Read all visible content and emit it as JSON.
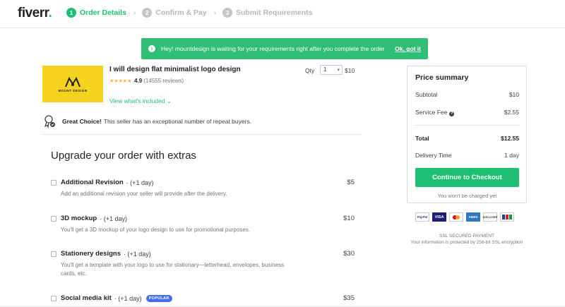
{
  "header": {
    "logo_text": "fiverr",
    "logo_dot": ".",
    "steps": [
      {
        "num": "1",
        "label": "Order Details"
      },
      {
        "num": "2",
        "label": "Confirm & Pay"
      },
      {
        "num": "3",
        "label": "Submit Requirements"
      }
    ],
    "separator": "›"
  },
  "notice": {
    "icon": "i",
    "message": "Hey! mountdesign is waiting for your requirements right after you complete the order",
    "ok_label": "Ok, got it"
  },
  "gig": {
    "thumb_brand": "MOUNT DESIGN",
    "title": "I will design flat minimalist logo design",
    "stars": "★★★★★",
    "score": "4.9",
    "reviews": "(14555 reviews)",
    "dots": "·",
    "view_included": "View what's included ⌄",
    "qty_label": "Qty",
    "qty_value": "1",
    "price": "$10"
  },
  "great_choice": {
    "bold": "Great Choice!",
    "text": "This seller has an exceptional number of repeat buyers."
  },
  "extras": {
    "title": "Upgrade your order with extras",
    "items": [
      {
        "name": "Additional Revision",
        "days": "· (+1 day)",
        "price": "$5",
        "desc": "Add an additional revision your seller will provide after the delivery.",
        "badge": ""
      },
      {
        "name": "3D mockup",
        "days": "· (+1 day)",
        "price": "$10",
        "desc": "You'll get a 3D mockup of your logo design to use for promotional purposes.",
        "badge": ""
      },
      {
        "name": "Stationery designs",
        "days": "· (+1 day)",
        "price": "$30",
        "desc": "You'll get a template with your logo to use for stationary—letterhead, envelopes, business cards, etc.",
        "badge": ""
      },
      {
        "name": "Social media kit",
        "days": "· (+1 day)",
        "price": "$35",
        "desc": "",
        "badge": "POPULAR"
      }
    ]
  },
  "summary": {
    "title": "Price summary",
    "subtotal_label": "Subtotal",
    "subtotal_value": "$10",
    "fee_label": "Service Fee",
    "fee_help": "?",
    "fee_value": "$2.55",
    "total_label": "Total",
    "total_value": "$12.55",
    "delivery_label": "Delivery Time",
    "delivery_value": "1 day",
    "checkout_label": "Continue to Checkout",
    "not_charged": "You won't be charged yet"
  },
  "payments": {
    "paypal": "PayPal",
    "visa": "VISA",
    "amex": "AMEX",
    "discover": "DISCOVER"
  },
  "ssl": {
    "line1": "SSL SECURED PAYMENT",
    "line2": "Your information is protected by 256-bit SSL encryption"
  },
  "colors": {
    "brand_green": "#1dbf73",
    "notice_green": "#2fbe74",
    "star_yellow": "#ffb33e",
    "thumb_yellow": "#f4d21e",
    "badge_blue": "#446ee7"
  }
}
